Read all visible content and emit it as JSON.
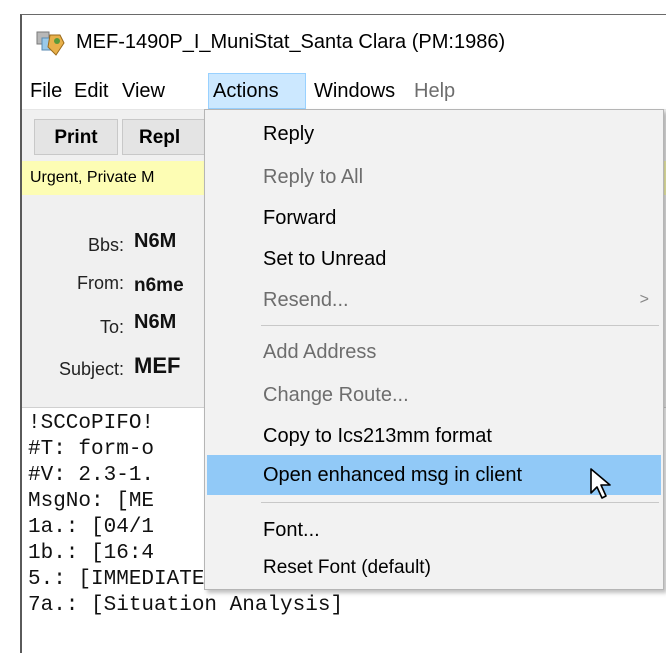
{
  "window": {
    "title": "MEF-1490P_I_MuniStat_Santa Clara  (PM:1986)"
  },
  "menubar": {
    "items": [
      {
        "label": "File",
        "state": "normal"
      },
      {
        "label": "Edit",
        "state": "normal"
      },
      {
        "label": "View",
        "state": "normal"
      },
      {
        "label": "Actions",
        "state": "active"
      },
      {
        "label": "Windows",
        "state": "normal"
      },
      {
        "label": "Help",
        "state": "disabled"
      }
    ]
  },
  "toolbar": {
    "print_label": "Print",
    "reply_label": "Repl"
  },
  "banner": {
    "text": "Urgent, Private M"
  },
  "header_fields": {
    "bbs": {
      "label": "Bbs:",
      "value": "N6M"
    },
    "from": {
      "label": "From:",
      "value": "n6me"
    },
    "to": {
      "label": "To:",
      "value": "N6M"
    },
    "subject": {
      "label": "Subject:",
      "value": "MEF"
    }
  },
  "message_body": {
    "lines": [
      "!SCCoPIFO!",
      "#T: form-o",
      "#V: 2.3-1.",
      "MsgNo: [ME",
      "1a.: [04/1",
      "1b.: [16:4",
      "5.: [IMMEDIATE]",
      "7a.: [Situation Analysis]"
    ]
  },
  "actions_menu": {
    "items": [
      {
        "label": "Reply",
        "enabled": true
      },
      {
        "label": "Reply to All",
        "enabled": false
      },
      {
        "label": "Forward",
        "enabled": true
      },
      {
        "label": "Set to Unread",
        "enabled": true
      },
      {
        "label": "Resend...",
        "enabled": false,
        "submenu_arrow": ">"
      },
      {
        "label": "Add Address",
        "enabled": false
      },
      {
        "label": "Change Route...",
        "enabled": false
      },
      {
        "label": "Copy to Ics213mm format",
        "enabled": true
      },
      {
        "label": "Open enhanced msg in client",
        "enabled": true,
        "highlighted": true
      },
      {
        "label": "Font...",
        "enabled": true
      },
      {
        "label": "Reset Font (default)",
        "enabled": true
      }
    ]
  },
  "colors": {
    "menu_active_bg": "#cce8ff",
    "menu_highlight_bg": "#91c9f7",
    "banner_bg": "#fdfdb4",
    "disabled_text": "#6d6d6d"
  }
}
